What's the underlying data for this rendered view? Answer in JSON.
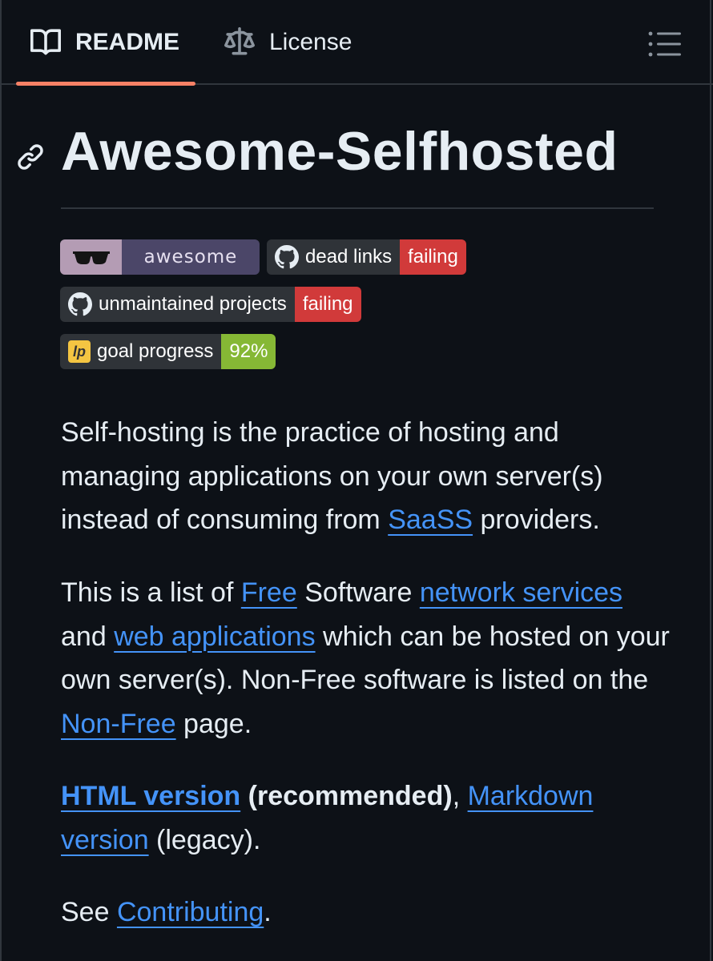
{
  "tabs": [
    {
      "label": "README",
      "icon": "book-icon",
      "active": true
    },
    {
      "label": "License",
      "icon": "law-icon",
      "active": false
    }
  ],
  "colors": {
    "background": "#0d1117",
    "text": "#e6edf3",
    "link": "#4493f8",
    "active_tab_underline": "#f78166",
    "badge_fail": "#d13a3a",
    "badge_pass": "#86b835"
  },
  "heading": "Awesome-Selfhosted",
  "badges": {
    "awesome": {
      "text": "awesome",
      "icon": "sunglasses-icon"
    },
    "dead_links": {
      "label": "dead links",
      "status": "failing",
      "icon": "github-icon"
    },
    "unmaintained": {
      "label": "unmaintained projects",
      "status": "failing",
      "icon": "github-icon"
    },
    "goal": {
      "label": "goal progress",
      "value": "92%",
      "icon": "liberapay-icon"
    }
  },
  "p1": {
    "t1": "Self-hosting is the practice of hosting and managing applications on your own server(s) instead of consuming from ",
    "link": "SaaSS",
    "t2": " providers."
  },
  "p2": {
    "t1": "This is a list of ",
    "link_free": "Free",
    "t2": " Software ",
    "link_network": "network services",
    "t3": " and ",
    "link_web": "web applications",
    "t4": " which can be hosted on your own server(s). Non-Free software is listed on the ",
    "link_nonfree": "Non-Free",
    "t5": " page."
  },
  "p3": {
    "link_html": "HTML version",
    "t1": " (recommended)",
    "t2": ", ",
    "link_md": "Markdown version",
    "t3": " (legacy)."
  },
  "p4": {
    "t1": "See ",
    "link": "Contributing",
    "t2": "."
  }
}
